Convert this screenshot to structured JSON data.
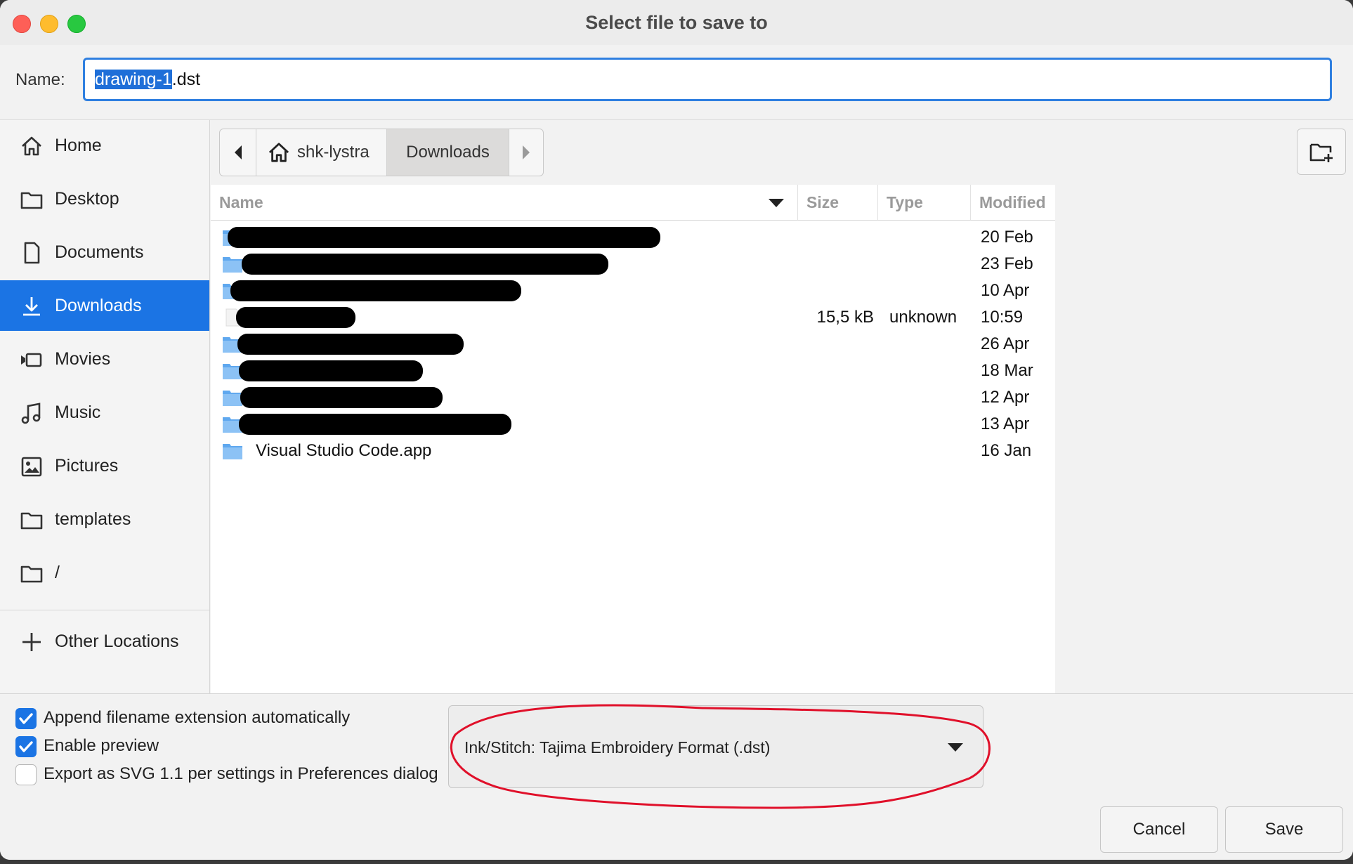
{
  "dialog": {
    "title": "Select file to save to"
  },
  "name_row": {
    "label": "Name:",
    "selected_part": "drawing-1",
    "extension": ".dst"
  },
  "sidebar": {
    "items": [
      {
        "label": "Home",
        "icon": "home-icon"
      },
      {
        "label": "Desktop",
        "icon": "folder-icon"
      },
      {
        "label": "Documents",
        "icon": "document-icon"
      },
      {
        "label": "Downloads",
        "icon": "download-icon",
        "active": true
      },
      {
        "label": "Movies",
        "icon": "movie-icon"
      },
      {
        "label": "Music",
        "icon": "music-icon"
      },
      {
        "label": "Pictures",
        "icon": "picture-icon"
      },
      {
        "label": "templates",
        "icon": "folder-icon"
      },
      {
        "label": "/",
        "icon": "folder-icon"
      }
    ],
    "other_locations": "Other Locations"
  },
  "pathbar": {
    "home_label": "shk-lystra",
    "current": "Downloads"
  },
  "columns": {
    "name": "Name",
    "size": "Size",
    "type": "Type",
    "modified": "Modified"
  },
  "files": [
    {
      "name": "",
      "size": "",
      "type": "",
      "modified": "20 Feb",
      "kind": "folder"
    },
    {
      "name": "",
      "size": "",
      "type": "",
      "modified": "23 Feb",
      "kind": "folder"
    },
    {
      "name": "",
      "size": "",
      "type": "",
      "modified": "10 Apr",
      "kind": "folder"
    },
    {
      "name": "",
      "size": "15,5 kB",
      "type": "unknown",
      "modified": "10:59",
      "kind": "file"
    },
    {
      "name": "",
      "size": "",
      "type": "",
      "modified": "26 Apr",
      "kind": "folder"
    },
    {
      "name": "",
      "size": "",
      "type": "",
      "modified": "18 Mar",
      "kind": "folder"
    },
    {
      "name": "",
      "size": "",
      "type": "",
      "modified": "12 Apr",
      "kind": "folder"
    },
    {
      "name": "",
      "size": "",
      "type": "",
      "modified": "13 Apr",
      "kind": "folder"
    },
    {
      "name": "Visual Studio Code.app",
      "size": "",
      "type": "",
      "modified": "16 Jan",
      "kind": "folder"
    }
  ],
  "options": {
    "append_extension": {
      "label": "Append filename extension automatically",
      "checked": true
    },
    "enable_preview": {
      "label": "Enable preview",
      "checked": true
    },
    "export_svg11": {
      "label": "Export as SVG 1.1 per settings in Preferences dialog",
      "checked": false
    }
  },
  "filter": {
    "selected": "Ink/Stitch: Tajima Embroidery Format (.dst)"
  },
  "buttons": {
    "cancel": "Cancel",
    "save": "Save"
  },
  "colors": {
    "accent": "#1b74e4",
    "annotation": "#e0102a",
    "folder": "#5fa8ef"
  }
}
